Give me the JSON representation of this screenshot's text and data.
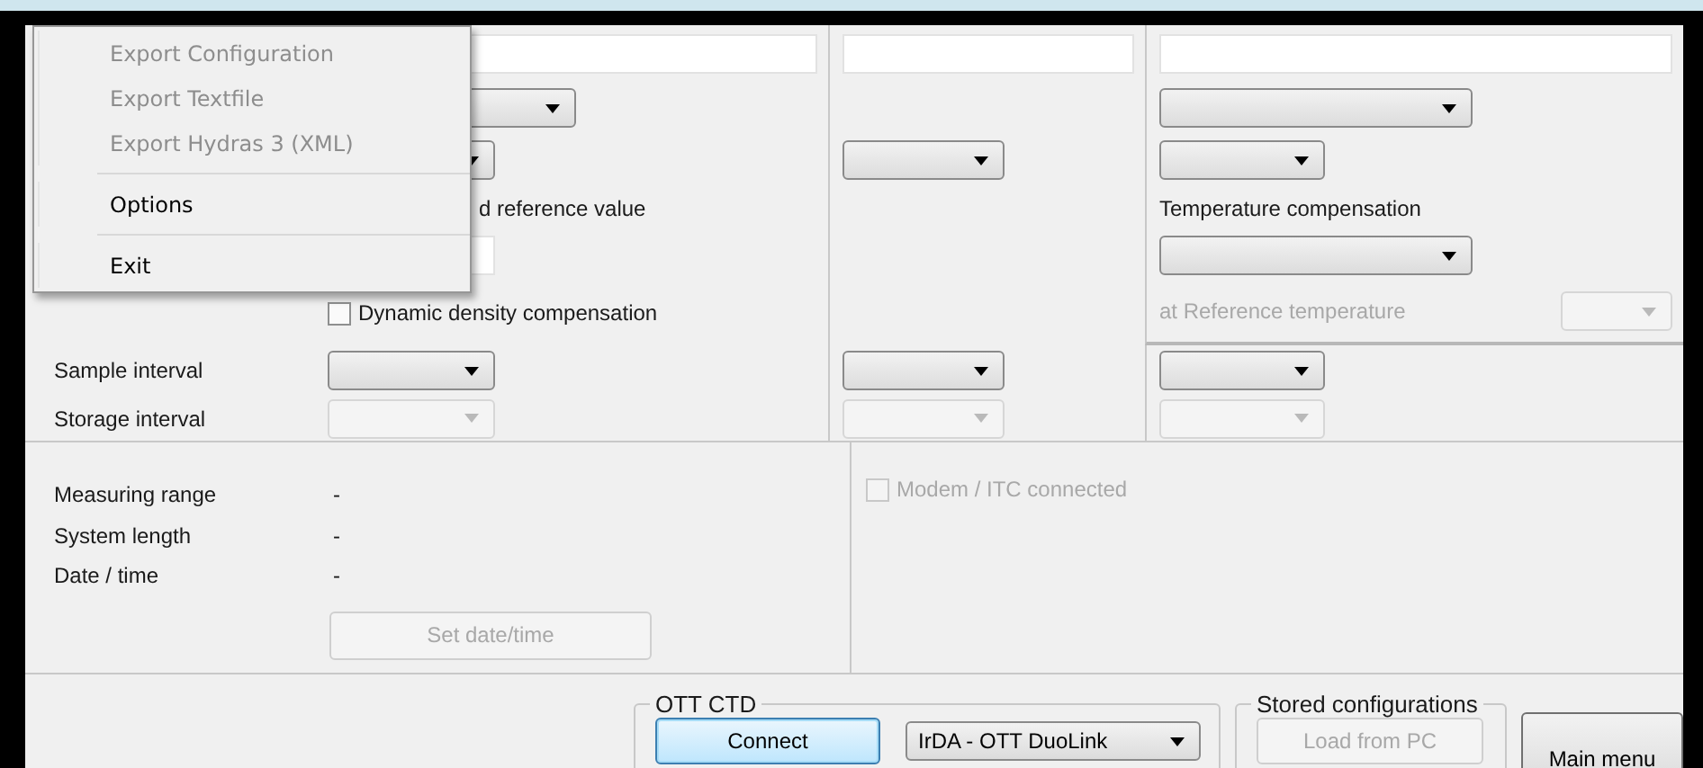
{
  "menu": {
    "items": [
      {
        "kind": "item",
        "label": "Export Configuration",
        "disabled": true
      },
      {
        "kind": "item",
        "label": "Export Textfile",
        "disabled": true
      },
      {
        "kind": "item",
        "label": "Export Hydras 3 (XML)",
        "disabled": true
      },
      {
        "kind": "separator"
      },
      {
        "kind": "item",
        "label": "Options",
        "disabled": false
      },
      {
        "kind": "separator"
      },
      {
        "kind": "item",
        "label": "Exit",
        "disabled": false
      }
    ]
  },
  "settings": {
    "rows": [
      {
        "cells": [
          [
            {
              "kind": "text"
            }
          ],
          [
            {
              "kind": "text"
            }
          ],
          [
            {
              "kind": "text"
            }
          ]
        ]
      },
      {
        "cells": [
          [
            {
              "kind": "dropdown",
              "disabled": false
            }
          ],
          [],
          [
            {
              "kind": "dropdown",
              "disabled": false
            }
          ]
        ]
      },
      {
        "cells": [
          [
            {
              "kind": "dropdown",
              "disabled": false
            }
          ],
          [
            {
              "kind": "dropdown",
              "disabled": false
            }
          ],
          [
            {
              "kind": "dropdown",
              "disabled": false
            }
          ]
        ]
      },
      {
        "cells": [
          [
            {
              "kind": "caption",
              "label": "d reference value",
              "disabled": false
            }
          ],
          [],
          [
            {
              "kind": "caption",
              "label": "Temperature compensation",
              "disabled": false
            }
          ]
        ]
      },
      {
        "cells": [
          [
            {
              "kind": "text"
            }
          ],
          [],
          [
            {
              "kind": "dropdown",
              "disabled": false
            }
          ]
        ]
      },
      {
        "cells": [
          [
            {
              "kind": "checkbox",
              "label": "Dynamic density compensation",
              "checked": false,
              "disabled": false
            }
          ],
          [],
          [
            {
              "kind": "caption",
              "label": "at Reference temperature",
              "disabled": true
            },
            {
              "kind": "dropdown",
              "disabled": true
            }
          ]
        ]
      },
      {
        "label": "Sample interval",
        "cells": [
          [
            {
              "kind": "dropdown",
              "disabled": false
            }
          ],
          [
            {
              "kind": "dropdown",
              "disabled": false
            }
          ],
          [
            {
              "kind": "dropdown",
              "disabled": false
            }
          ]
        ]
      },
      {
        "label": "Storage interval",
        "cells": [
          [
            {
              "kind": "dropdown",
              "disabled": true
            }
          ],
          [
            {
              "kind": "dropdown",
              "disabled": true
            }
          ],
          [
            {
              "kind": "dropdown",
              "disabled": true
            }
          ]
        ]
      }
    ]
  },
  "info": {
    "rows": [
      {
        "label": "Measuring range",
        "value": "-"
      },
      {
        "label": "System length",
        "value": "-"
      },
      {
        "label": "Date / time",
        "value": "-"
      }
    ],
    "set_button": {
      "label": "Set date/time",
      "disabled": true
    },
    "modem": {
      "label": "Modem / ITC connected",
      "checked": false,
      "disabled": true
    }
  },
  "connection": {
    "title": "OTT CTD",
    "connect": "Connect",
    "port": "IrDA - OTT DuoLink"
  },
  "stored": {
    "title": "Stored configurations",
    "load": {
      "label": "Load from PC",
      "disabled": true
    }
  },
  "main_menu": "Main menu"
}
